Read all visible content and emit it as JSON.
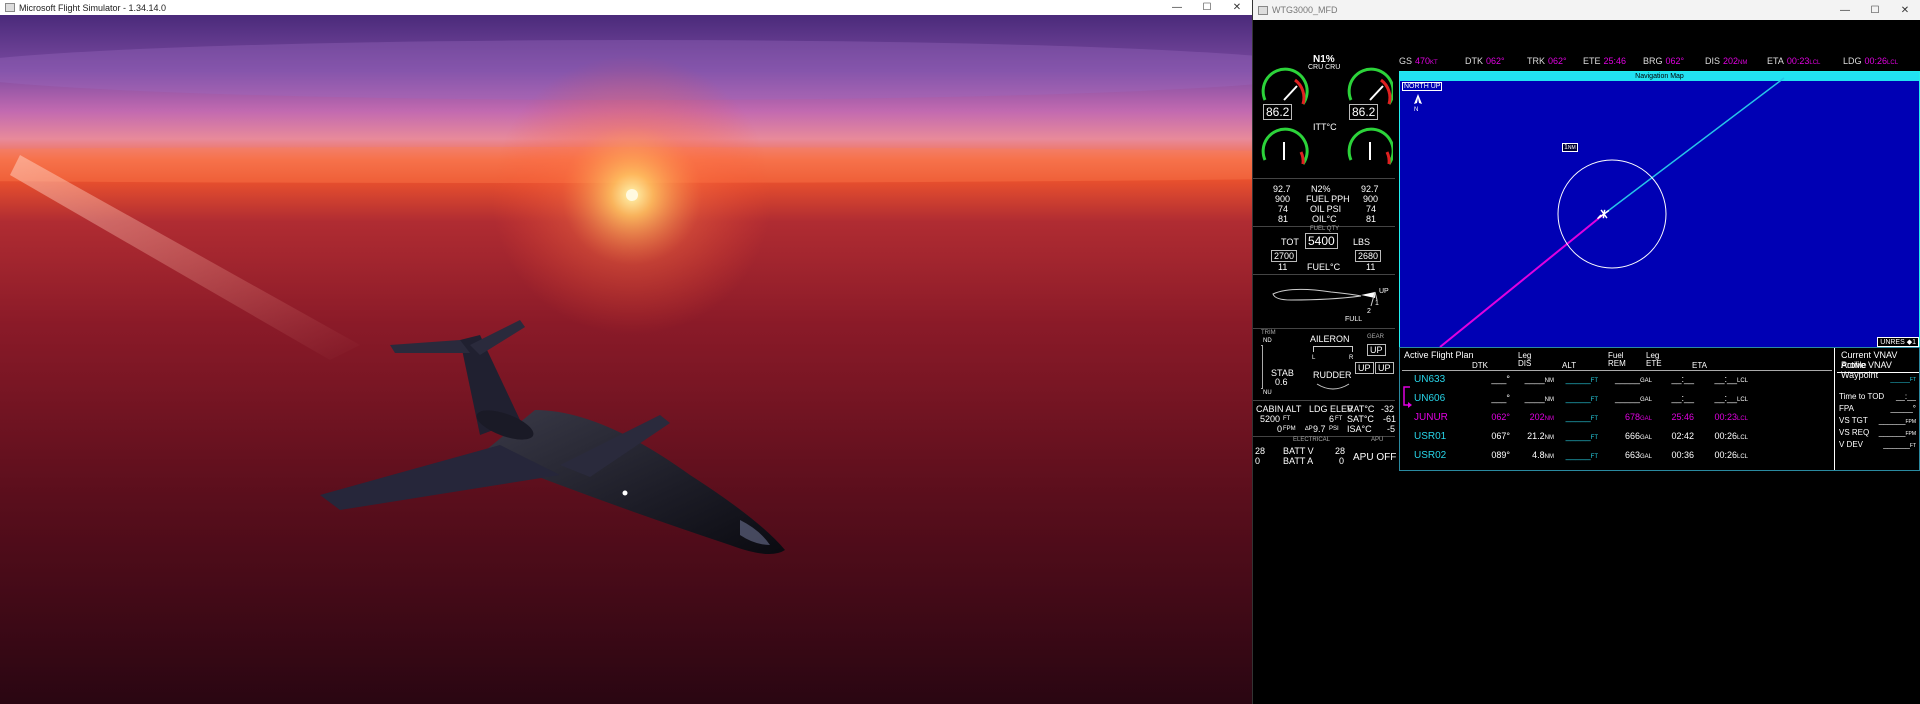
{
  "sim_window": {
    "title": "Microsoft Flight Simulator - 1.34.14.0",
    "buttons": {
      "minimize": "—",
      "maximize": "☐",
      "close": "✕"
    }
  },
  "mfd_window": {
    "title": "WTG3000_MFD",
    "buttons": {
      "minimize": "—",
      "maximize": "☐",
      "close": "✕"
    }
  },
  "eis": {
    "n1_label": "N1%",
    "n1_mode": "CRU CRU",
    "n1_left": "86.2",
    "n1_right": "86.2",
    "itt_label": "ITT°C",
    "n2_left": "92.7",
    "n2_label": "N2%",
    "n2_right": "92.7",
    "fuel_pph_left": "900",
    "fuel_pph_label": "FUEL PPH",
    "fuel_pph_right": "900",
    "oil_psi_left": "74",
    "oil_psi_label": "OIL PSI",
    "oil_psi_right": "74",
    "oil_c_left": "81",
    "oil_c_label": "OIL°C",
    "oil_c_right": "81",
    "fuel_qty_label": "FUEL QTY",
    "tot_label": "TOT",
    "tot_value": "5400",
    "tot_unit": "LBS",
    "fuel_left": "2700",
    "fuel_right": "2680",
    "fuel_c_left": "11",
    "fuel_c_label": "FUEL°C",
    "fuel_c_right": "11",
    "flaps_up": "UP",
    "flaps_one": "1",
    "flaps_two": "2",
    "flaps_full": "FULL",
    "trim_label": "TRIM",
    "trim_nd": "ND",
    "trim_nu": "NU",
    "stab_label": "STAB",
    "stab_value": "0.6",
    "aileron_label": "AILERON",
    "aileron_l": "L",
    "aileron_r": "R",
    "rudder_label": "RUDDER",
    "gear_label": "GEAR",
    "gear_nose": "UP",
    "gear_left": "UP",
    "gear_right": "UP",
    "cabin_alt_label": "CABIN ALT",
    "cabin_alt_value": "5200",
    "cabin_alt_unit": "FT",
    "cabin_rate": "0",
    "cabin_rate_unit": "FPM",
    "ldg_elev_label": "LDG ELEV",
    "ldg_elev_value": "6",
    "ldg_elev_unit": "FT",
    "dp_label": "∆P",
    "dp_value": "9.7",
    "dp_unit": "PSI",
    "rat_label": "RAT°C",
    "rat_value": "-32",
    "sat_label": "SAT°C",
    "sat_value": "-61",
    "isa_label": "ISA°C",
    "isa_value": "-5",
    "electrical_label": "ELECTRICAL",
    "batt_v_left": "28",
    "batt_v_label": "BATT V",
    "batt_v_right": "28",
    "batt_a_left": "0",
    "batt_a_label": "BATT A",
    "batt_a_right": "0",
    "apu_label": "APU",
    "apu_status": "APU OFF"
  },
  "nav_header": {
    "gs_k": "GS",
    "gs_v": "470",
    "gs_u": "KT",
    "dtk_k": "DTK",
    "dtk_v": "062°",
    "trk_k": "TRK",
    "trk_v": "062°",
    "ete_k": "ETE",
    "ete_v": "25:46",
    "brg_k": "BRG",
    "brg_v": "062°",
    "dis_k": "DIS",
    "dis_v": "202",
    "dis_u": "NM",
    "eta_k": "ETA",
    "eta_v": "00:23",
    "eta_u": "LCL",
    "ldg_k": "LDG",
    "ldg_v": "00:26",
    "ldg_u": "LCL"
  },
  "map": {
    "title": "Navigation Map",
    "orientation": "NORTH UP",
    "range": "1",
    "range_unit": "NM",
    "unres": "UNRES ◆1"
  },
  "flight_plan": {
    "title": "Active Flight Plan",
    "columns": {
      "dtk": "DTK",
      "leg_dis_1": "Leg",
      "leg_dis_2": "DIS",
      "alt": "ALT",
      "fuel_rem_1": "Fuel",
      "fuel_rem_2": "REM",
      "leg_ete_1": "Leg",
      "leg_ete_2": "ETE",
      "eta": "ETA"
    },
    "rows": [
      {
        "name": "UN633",
        "dtk": "___°",
        "dis": "____",
        "dis_u": "NM",
        "alt": "_____",
        "alt_u": "FT",
        "fuel": "_____",
        "fuel_u": "GAL",
        "ete": "__:__",
        "eta": "__:__",
        "eta_u": "LCL"
      },
      {
        "name": "UN606",
        "dtk": "___°",
        "dis": "____",
        "dis_u": "NM",
        "alt": "_____",
        "alt_u": "FT",
        "fuel": "_____",
        "fuel_u": "GAL",
        "ete": "__:__",
        "eta": "__:__",
        "eta_u": "LCL"
      },
      {
        "name": "JUNUR",
        "dtk": "062°",
        "dis": "202",
        "dis_u": "NM",
        "alt": "_____",
        "alt_u": "FT",
        "fuel": "678",
        "fuel_u": "GAL",
        "ete": "25:46",
        "eta": "00:23",
        "eta_u": "LCL"
      },
      {
        "name": "USR01",
        "dtk": "067°",
        "dis": "21.2",
        "dis_u": "NM",
        "alt": "_____",
        "alt_u": "FT",
        "fuel": "666",
        "fuel_u": "GAL",
        "ete": "02:42",
        "eta": "00:26",
        "eta_u": "LCL"
      },
      {
        "name": "USR02",
        "dtk": "089°",
        "dis": "4.8",
        "dis_u": "NM",
        "alt": "_____",
        "alt_u": "FT",
        "fuel": "663",
        "fuel_u": "GAL",
        "ete": "00:36",
        "eta": "00:26",
        "eta_u": "LCL"
      }
    ]
  },
  "vnav": {
    "title1": "Current VNAV Profile",
    "title2": "Active VNAV Waypoint",
    "wpt_alt": "_____",
    "wpt_alt_u": "FT",
    "ttod_label": "Time to TOD",
    "ttod_value": "__:__",
    "fpa_label": "FPA",
    "fpa_value": "_____°",
    "vstgt_label": "VS TGT",
    "vstgt_value": "______",
    "vstgt_u": "FPM",
    "vsreq_label": "VS REQ",
    "vsreq_value": "______",
    "vsreq_u": "FPM",
    "vdev_label": "V DEV",
    "vdev_value": "______",
    "vdev_u": "FT"
  }
}
